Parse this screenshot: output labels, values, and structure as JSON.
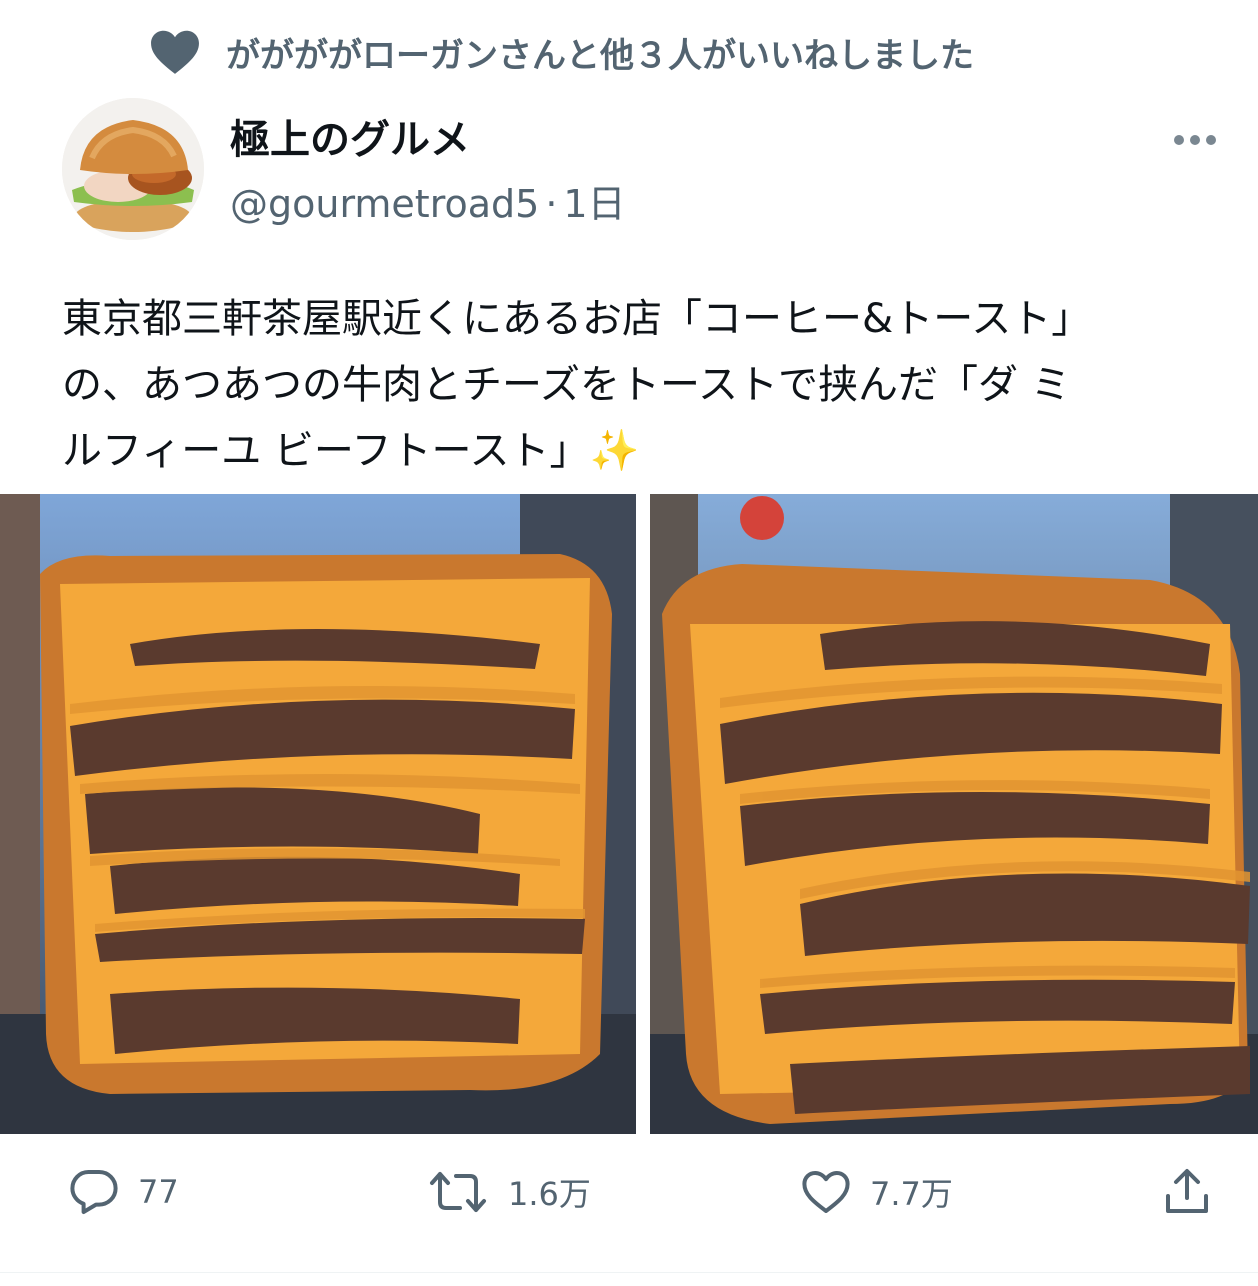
{
  "social_context": {
    "text": "ががががローガンさんと他３人がいいねしました",
    "icon": "heart-icon"
  },
  "author": {
    "display_name": "極上のグルメ",
    "handle": "@gourmetroad5",
    "separator": "·",
    "time": "1日",
    "avatar_icon": "hamburger-avatar"
  },
  "tweet": {
    "text_lines": [
      "東京都三軒茶屋駅近くにあるお店「コーヒー&トースト」",
      "の、あつあつの牛肉とチーズをトーストで挟んだ「ダ ミ",
      "ルフィーユ ビーフトースト」✨"
    ]
  },
  "media": {
    "photos": [
      {
        "subject": "beef-and-cheese-toast-photo"
      },
      {
        "subject": "beef-and-cheese-toast-photo"
      }
    ]
  },
  "actions": {
    "reply_count": "77",
    "retweet_count": "1.6万",
    "like_count": "7.7万"
  },
  "colors": {
    "text_primary": "#0f1419",
    "text_secondary": "#536471",
    "cheese": "#f4a83a",
    "toast": "#c9782e",
    "beef": "#5a3a2e"
  }
}
